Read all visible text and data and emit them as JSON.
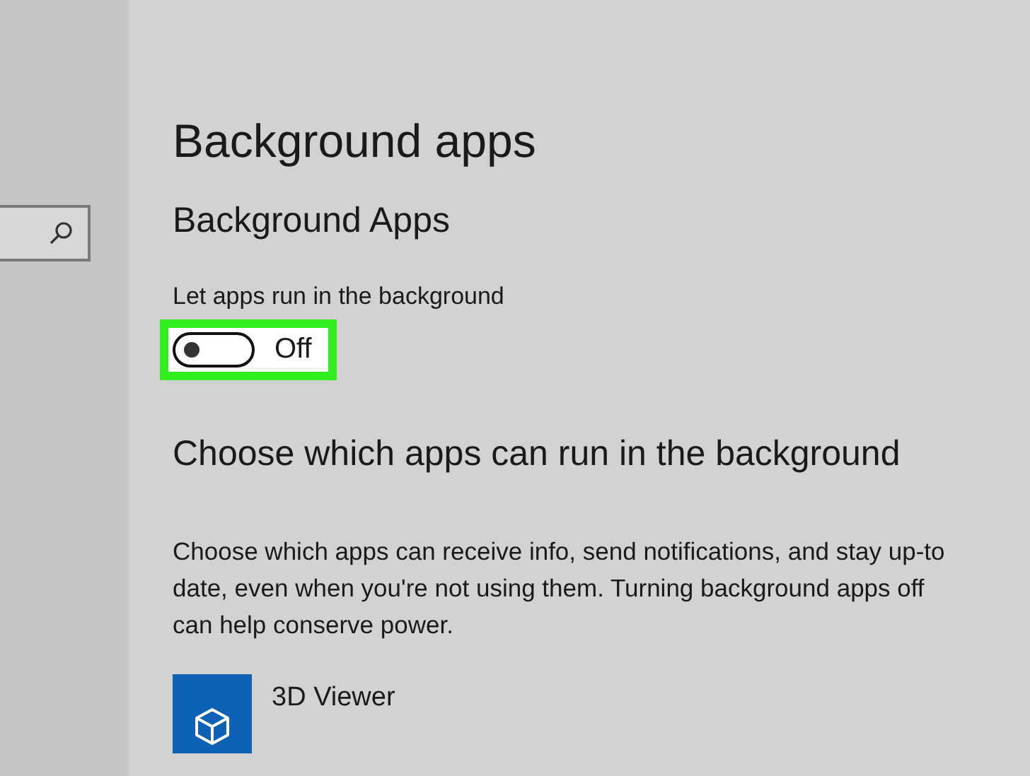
{
  "sidebar": {
    "search": {
      "kind": "search"
    }
  },
  "page": {
    "title": "Background apps",
    "section_title": "Background Apps",
    "toggle": {
      "label": "Let apps run in the background",
      "on": false,
      "state_text": "Off",
      "highlighted": true
    },
    "list_heading": "Choose which apps can run in the background",
    "description_lines": [
      "Choose which apps can receive info, send notifications, and stay up-to",
      "date, even when you're not using them. Turning background apps off",
      "can help conserve power."
    ],
    "apps": [
      {
        "name": "3D Viewer"
      }
    ]
  }
}
